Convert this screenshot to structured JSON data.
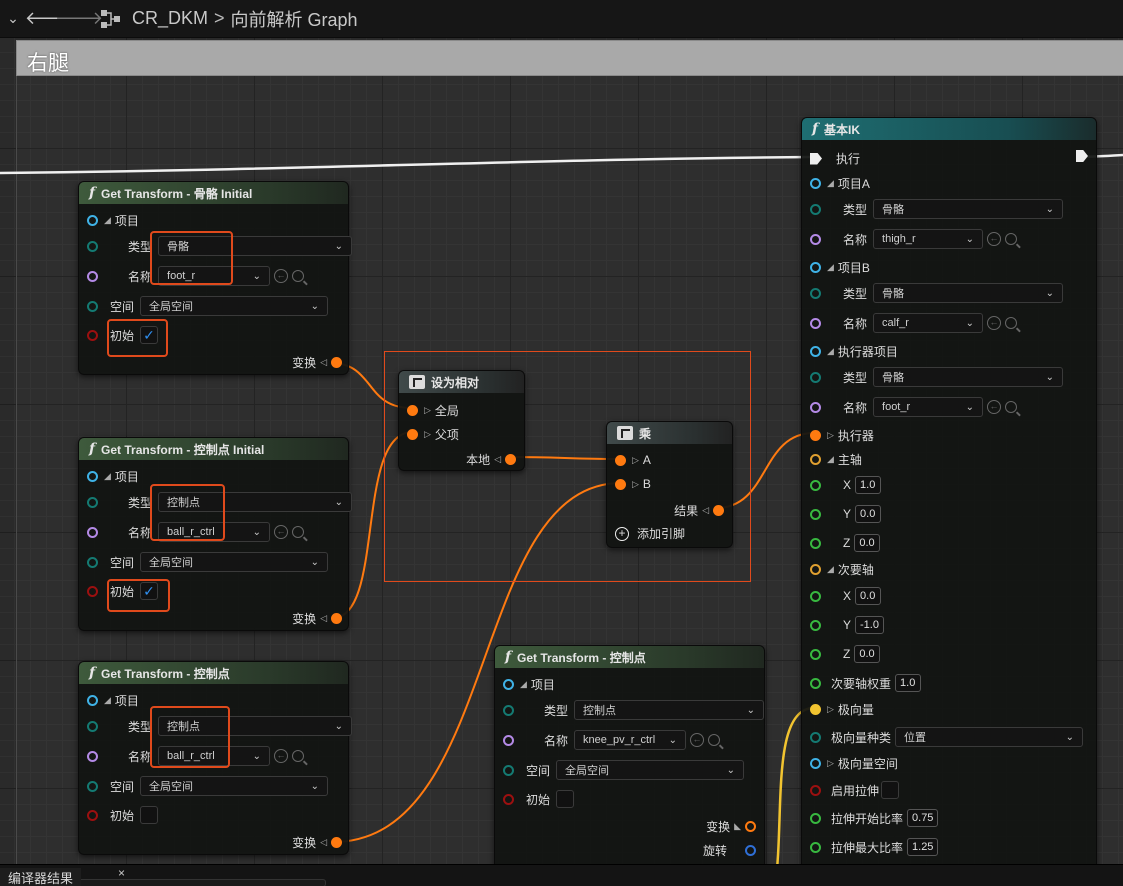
{
  "toolbar": {
    "menu_icon": "chevron-down-icon",
    "back_icon": "arrow-left-icon",
    "forward_icon": "arrow-right-icon",
    "graph_icon": "graph-icon",
    "asset": "CR_DKM",
    "separator": ">",
    "graph": "向前解析 Graph"
  },
  "comment": {
    "title": "右腿"
  },
  "nodes": {
    "gt_bone_initial": {
      "title": "Get Transform - 骨骼 Initial",
      "item": "项目",
      "type_label": "类型",
      "type_value": "骨骼",
      "name_label": "名称",
      "name_value": "foot_r",
      "space_label": "空间",
      "space_value": "全局空间",
      "initial_label": "初始",
      "initial_checked": true,
      "transform_label": "变换"
    },
    "gt_ctrl_initial": {
      "title": "Get Transform - 控制点 Initial",
      "item": "项目",
      "type_label": "类型",
      "type_value": "控制点",
      "name_label": "名称",
      "name_value": "ball_r_ctrl",
      "space_label": "空间",
      "space_value": "全局空间",
      "initial_label": "初始",
      "initial_checked": true,
      "transform_label": "变换"
    },
    "gt_ctrl": {
      "title": "Get Transform - 控制点",
      "item": "项目",
      "type_label": "类型",
      "type_value": "控制点",
      "name_label": "名称",
      "name_value": "ball_r_ctrl",
      "space_label": "空间",
      "space_value": "全局空间",
      "initial_label": "初始",
      "initial_checked": false,
      "transform_label": "变换"
    },
    "make_relative": {
      "title": "设为相对",
      "global": "全局",
      "parent": "父项",
      "local": "本地"
    },
    "multiply": {
      "title": "乘",
      "a": "A",
      "b": "B",
      "result": "结果",
      "add_pin": "添加引脚"
    },
    "gt_knee": {
      "title": "Get Transform - 控制点",
      "item": "项目",
      "type_label": "类型",
      "type_value": "控制点",
      "name_label": "名称",
      "name_value": "knee_pv_r_ctrl",
      "space_label": "空间",
      "space_value": "全局空间",
      "initial_label": "初始",
      "transform_label": "变换",
      "rotation_label": "旋转"
    },
    "basic_ik": {
      "title": "基本IK",
      "exec": "执行",
      "item_a": "项目A",
      "type_label": "类型",
      "type_a": "骨骼",
      "name_label": "名称",
      "name_a": "thigh_r",
      "item_b": "项目B",
      "type_b": "骨骼",
      "name_b": "calf_r",
      "effector_item": "执行器项目",
      "type_e": "骨骼",
      "name_e": "foot_r",
      "effector": "执行器",
      "primary_axis": "主轴",
      "px": "1.0",
      "py": "0.0",
      "pz": "0.0",
      "secondary_axis": "次要轴",
      "sx": "0.0",
      "sy": "-1.0",
      "sz": "0.0",
      "secondary_weight_label": "次要轴权重",
      "secondary_weight": "1.0",
      "pole_vector": "极向量",
      "pole_kind_label": "极向量种类",
      "pole_kind": "位置",
      "pole_space": "极向量空间",
      "stretch_label": "启用拉伸",
      "stretch_start_label": "拉伸开始比率",
      "stretch_start": "0.75",
      "stretch_max_label": "拉伸最大比率",
      "stretch_max": "1.25",
      "x": "X",
      "y": "Y",
      "z": "Z"
    }
  },
  "bottom": {
    "tab": "编译器结果",
    "close": "×"
  },
  "colors": {
    "wire_orange": "#ff7a10",
    "wire_yellow": "#f2c430",
    "wire_white": "#ffffff",
    "highlight": "#e04a1c"
  }
}
